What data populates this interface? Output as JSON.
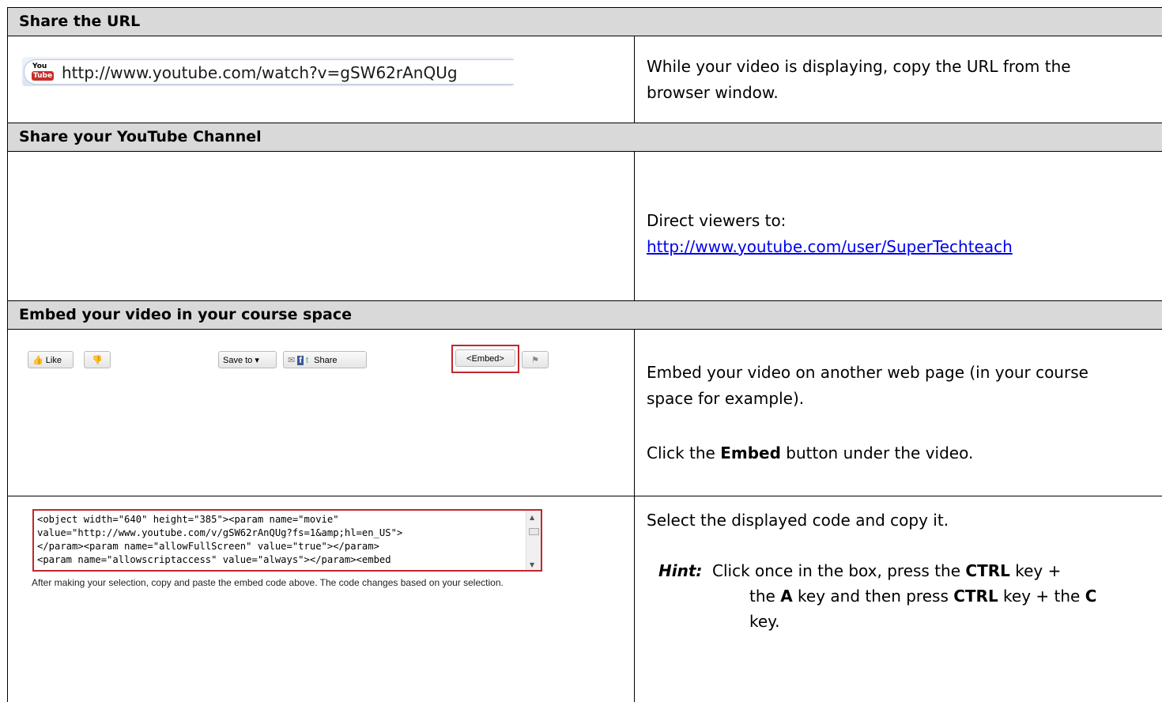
{
  "sections": [
    {
      "header": "Share the URL",
      "url_bar": {
        "icon": "youtube-logo",
        "logo_top": "You",
        "logo_bottom": "Tube",
        "url": "http://www.youtube.com/watch?v=gSW62rAnQUg"
      },
      "instruction": "While your video is displaying, copy the URL from the browser window."
    },
    {
      "header": "Share your YouTube Channel",
      "instruction_prefix": "Direct viewers to:",
      "link": "http://www.youtube.com/user/SuperTechteach"
    },
    {
      "header": "Embed your video in your course space",
      "toolbar": {
        "like": "Like",
        "save_to": "Save to",
        "share": "Share",
        "embed": "<Embed>"
      },
      "instruction_1": "Embed your video on another web page (in your course space for example).",
      "instruction_2_prefix": "Click the ",
      "instruction_2_bold": "Embed",
      "instruction_2_suffix": " button under the video."
    },
    {
      "code_lines": [
        "<object width=\"640\" height=\"385\"><param name=\"movie\"",
        "value=\"http://www.youtube.com/v/gSW62rAnQUg?fs=1&amp;hl=en_US\">",
        "</param><param name=\"allowFullScreen\" value=\"true\"></param>",
        "<param name=\"allowscriptaccess\" value=\"always\"></param><embed"
      ],
      "caption": "After making your selection, copy and paste the embed code above. The code changes based on your selection.",
      "instruction": "Select the displayed code and copy it.",
      "hint_label": "Hint:",
      "hint": {
        "p1": " Click once in the box, press the ",
        "b1": "CTRL",
        "p2": " key + the ",
        "b2": "A",
        "p3": " key and then press ",
        "b3": "CTRL",
        "p4": " key  + the ",
        "b4": "C",
        "p5": " key."
      }
    }
  ],
  "colors": {
    "header_bg": "#d9d9d9",
    "highlight": "#c1272d",
    "link": "#0000ee"
  }
}
